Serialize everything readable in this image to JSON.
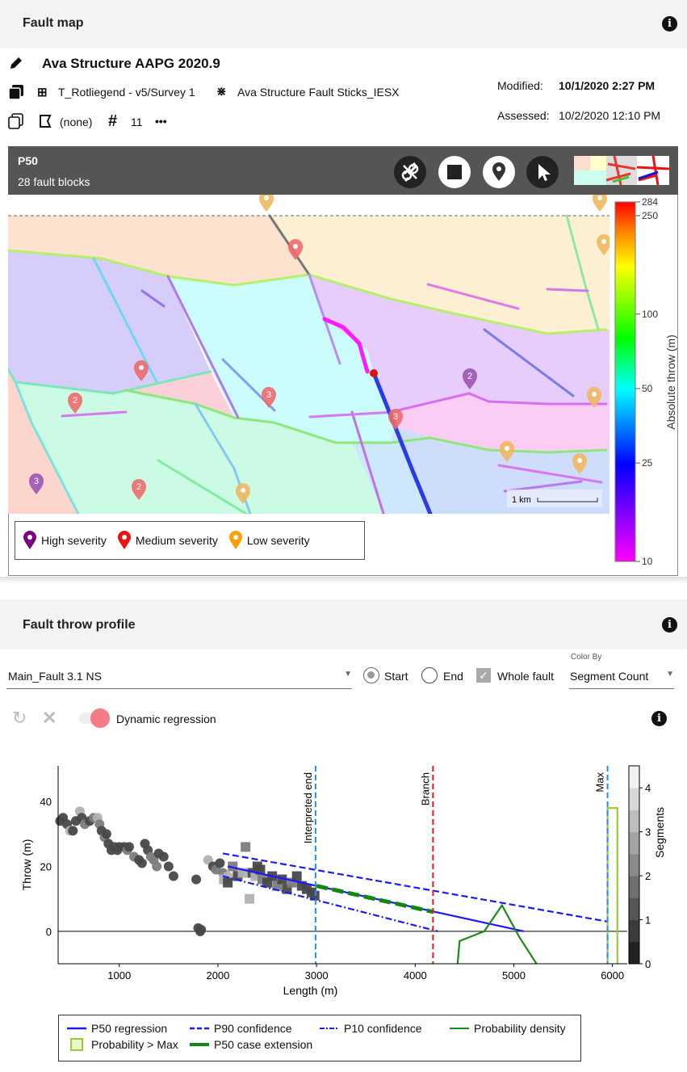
{
  "fault_map": {
    "title": "Fault map",
    "name": "Ava Structure AAPG 2020.9",
    "surface": "T_Rotliegend - v5/Survey 1",
    "sticks": "Ava Structure Fault Sticks_IESX",
    "polygon": "(none)",
    "count": "11",
    "more": "•••",
    "modified_label": "Modified:",
    "modified_value": "10/1/2020 2:27 PM",
    "assessed_label": "Assessed:",
    "assessed_value": "10/2/2020 12:10 PM",
    "toolbar": {
      "case": "P50",
      "blocks": "28 fault blocks"
    },
    "tools": [
      "unlink-icon",
      "stop-icon",
      "pin-icon",
      "pointer-icon"
    ],
    "scale_bar": "1 km",
    "colorbar": {
      "label": "Absolute throw (m)",
      "min": 10,
      "max": 284,
      "scale": "log",
      "ticks": [
        "284",
        "250",
        "100",
        "50",
        "25",
        "10"
      ],
      "colormap": "magenta-blue-cyan-green-yellow-red"
    },
    "severity_legend": [
      {
        "label": "High severity",
        "color": "#7a0080"
      },
      {
        "label": "Medium severity",
        "color": "#ee1111"
      },
      {
        "label": "Low severity",
        "color": "#ffa000"
      }
    ],
    "pins": [
      {
        "severity": "low",
        "badge": ""
      },
      {
        "severity": "low",
        "badge": ""
      },
      {
        "severity": "low",
        "badge": ""
      },
      {
        "severity": "medium",
        "badge": ""
      },
      {
        "severity": "medium",
        "badge": ""
      },
      {
        "severity": "medium",
        "badge": "2"
      },
      {
        "severity": "medium",
        "badge": "3"
      },
      {
        "severity": "high",
        "badge": "2"
      },
      {
        "severity": "medium",
        "badge": "3"
      },
      {
        "severity": "low",
        "badge": ""
      },
      {
        "severity": "low",
        "badge": ""
      },
      {
        "severity": "low",
        "badge": ""
      },
      {
        "severity": "high",
        "badge": "3"
      },
      {
        "severity": "medium",
        "badge": "2"
      },
      {
        "severity": "low",
        "badge": ""
      }
    ]
  },
  "profile": {
    "title": "Fault throw profile",
    "fault_select": "Main_Fault 3.1 NS",
    "start_label": "Start",
    "end_label": "End",
    "whole_fault_label": "Whole fault",
    "start_selected": true,
    "whole_fault_checked": true,
    "color_by_label": "Color By",
    "color_by_value": "Segment Count",
    "dynamic_regression_label": "Dynamic regression",
    "dynamic_regression_on": true
  },
  "chart_data": {
    "type": "scatter",
    "xlabel": "Length (m)",
    "ylabel": "Throw (m)",
    "xlim": [
      380,
      6150
    ],
    "ylim": [
      -10,
      51
    ],
    "xticks": [
      1000,
      2000,
      3000,
      4000,
      5000,
      6000
    ],
    "yticks": [
      0,
      20,
      40
    ],
    "colorbar": {
      "label": "Segments",
      "min": 0,
      "max": 4.5,
      "ticks": [
        0,
        1,
        2,
        3,
        4
      ],
      "colormap": "gray"
    },
    "circles": [
      [
        400,
        34,
        1
      ],
      [
        430,
        35,
        1
      ],
      [
        470,
        33,
        1
      ],
      [
        500,
        31,
        3
      ],
      [
        530,
        31,
        1
      ],
      [
        560,
        34,
        1
      ],
      [
        600,
        37,
        3
      ],
      [
        620,
        35,
        1
      ],
      [
        650,
        33,
        2
      ],
      [
        700,
        34,
        1
      ],
      [
        740,
        35,
        2
      ],
      [
        780,
        35,
        3
      ],
      [
        800,
        33,
        2
      ],
      [
        820,
        31,
        1
      ],
      [
        850,
        29,
        2
      ],
      [
        870,
        30,
        1
      ],
      [
        890,
        27,
        1
      ],
      [
        920,
        25,
        1
      ],
      [
        950,
        26,
        1
      ],
      [
        980,
        25,
        1
      ],
      [
        1000,
        26,
        1
      ],
      [
        1050,
        26,
        1
      ],
      [
        1080,
        25,
        2
      ],
      [
        1100,
        26,
        1
      ],
      [
        1150,
        23,
        2
      ],
      [
        1200,
        22,
        1
      ],
      [
        1230,
        21,
        1
      ],
      [
        1260,
        27,
        1
      ],
      [
        1290,
        25,
        1
      ],
      [
        1320,
        23,
        2
      ],
      [
        1350,
        22,
        2
      ],
      [
        1380,
        20,
        2
      ],
      [
        1400,
        24,
        1
      ],
      [
        1450,
        23,
        1
      ],
      [
        1500,
        20,
        1
      ],
      [
        1550,
        17,
        1
      ],
      [
        1780,
        16,
        1
      ],
      [
        1800,
        1,
        1
      ],
      [
        1820,
        0,
        1
      ],
      [
        1830,
        0.5,
        1
      ],
      [
        1900,
        22,
        3
      ],
      [
        1950,
        20,
        1
      ],
      [
        1980,
        19,
        2
      ],
      [
        2020,
        21,
        1
      ],
      [
        2050,
        18,
        2
      ],
      [
        2100,
        17,
        3
      ]
    ],
    "squares": [
      [
        2060,
        16,
        3
      ],
      [
        2100,
        15,
        1
      ],
      [
        2150,
        20,
        2
      ],
      [
        2200,
        17,
        1
      ],
      [
        2250,
        18,
        3
      ],
      [
        2280,
        26,
        2
      ],
      [
        2320,
        10,
        3
      ],
      [
        2350,
        18,
        1
      ],
      [
        2380,
        17,
        3
      ],
      [
        2400,
        20,
        1
      ],
      [
        2430,
        19,
        1
      ],
      [
        2450,
        16,
        2
      ],
      [
        2500,
        15,
        1
      ],
      [
        2550,
        17,
        1
      ],
      [
        2600,
        14,
        2
      ],
      [
        2650,
        16,
        1
      ],
      [
        2700,
        13,
        1
      ],
      [
        2750,
        15,
        2
      ],
      [
        2800,
        17,
        1
      ],
      [
        2850,
        14,
        1
      ],
      [
        2900,
        13,
        1
      ],
      [
        2950,
        12,
        1
      ],
      [
        2980,
        11,
        1
      ]
    ],
    "lines": [
      {
        "name": "P50 regression",
        "style": "solid",
        "color": "#1a1aff",
        "points": [
          [
            2100,
            20
          ],
          [
            5100,
            0
          ]
        ]
      },
      {
        "name": "P90 confidence",
        "style": "dashed",
        "color": "#1a1aff",
        "points": [
          [
            2050,
            24
          ],
          [
            5950,
            3
          ]
        ]
      },
      {
        "name": "P10 confidence",
        "style": "dashdot",
        "color": "#1a1aff",
        "points": [
          [
            2050,
            17
          ],
          [
            4230,
            0
          ]
        ]
      },
      {
        "name": "Probability density",
        "style": "solid",
        "color": "#1a8a1a",
        "points": [
          [
            4430,
            -10
          ],
          [
            4450,
            -3
          ],
          [
            4700,
            0
          ],
          [
            4880,
            8
          ],
          [
            5060,
            -2
          ],
          [
            5230,
            -10
          ]
        ]
      },
      {
        "name": "Probability > Max",
        "style": "solid",
        "color": "#9acd32",
        "points": [
          [
            5950,
            -10
          ],
          [
            5950,
            38
          ],
          [
            6050,
            38
          ],
          [
            6050,
            -10
          ]
        ]
      },
      {
        "name": "P50 case extension",
        "style": "dashed-thick",
        "color": "#118811",
        "points": [
          [
            3000,
            14
          ],
          [
            4180,
            6
          ]
        ]
      }
    ],
    "markers": [
      {
        "label": "Interpreted end",
        "x": 2990,
        "color": "#1e8fff"
      },
      {
        "label": "Branch",
        "x": 4180,
        "color": "#ff1a1a"
      },
      {
        "label": "Max",
        "x": 5950,
        "color": "#1e8fff"
      }
    ],
    "legend": [
      "P50 regression",
      "P90 confidence",
      "P10 confidence",
      "Probability density",
      "Probability > Max",
      "P50 case extension"
    ],
    "legend_position": "bottom"
  }
}
